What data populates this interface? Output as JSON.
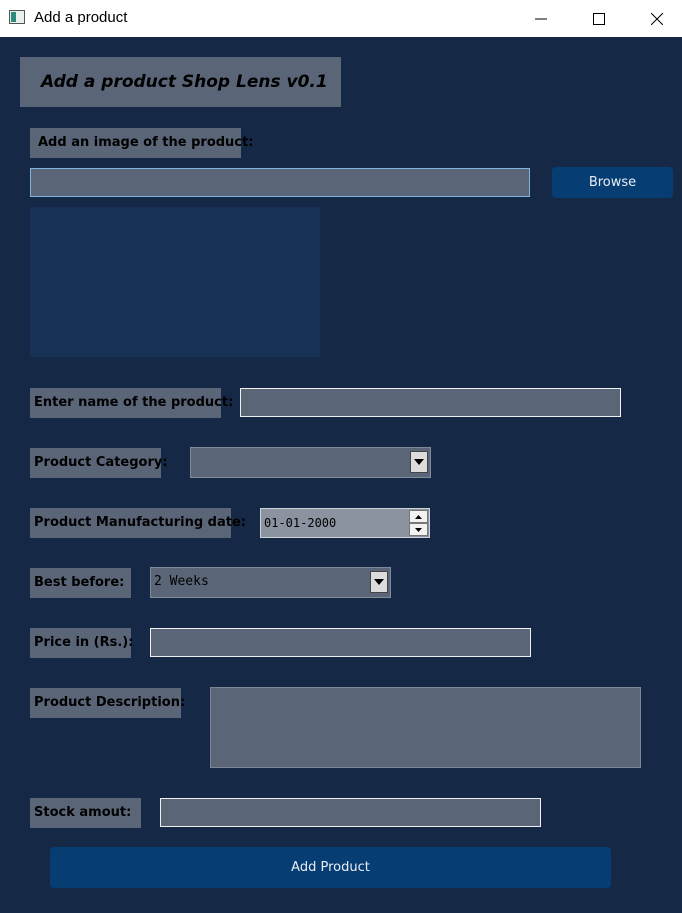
{
  "window": {
    "title": "Add a product"
  },
  "header": {
    "title": "Add a product Shop Lens v0.1"
  },
  "image_section": {
    "label": "Add an image of the product:",
    "path_value": "",
    "browse_label": "Browse"
  },
  "name_field": {
    "label": "Enter name of the product:",
    "value": ""
  },
  "category": {
    "label": "Product Category:",
    "selected": ""
  },
  "manufacturing": {
    "label": "Product Manufacturing date:",
    "value": "01-01-2000"
  },
  "best_before": {
    "label": "Best before:",
    "selected": "2 Weeks"
  },
  "price": {
    "label": "Price in (Rs.):",
    "value": ""
  },
  "description": {
    "label": "Product Description:",
    "value": ""
  },
  "stock": {
    "label": "Stock amout:",
    "value": ""
  },
  "submit": {
    "label": "Add Product"
  },
  "colors": {
    "background": "#152845",
    "panel": "#5a6678",
    "button": "#063d72"
  }
}
